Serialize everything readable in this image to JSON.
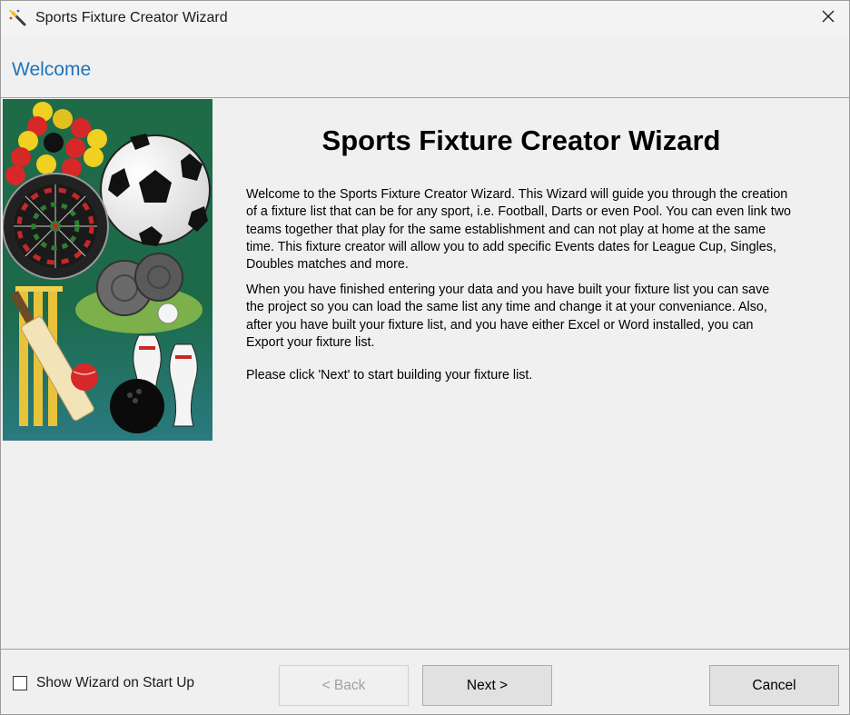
{
  "window": {
    "title": "Sports Fixture Creator Wizard"
  },
  "header": {
    "title": "Welcome"
  },
  "main": {
    "title": "Sports Fixture Creator Wizard",
    "paragraphs": [
      "Welcome to the Sports Fixture Creator Wizard. This Wizard will guide you through the creation of a fixture list that can be for any sport, i.e. Football, Darts or even Pool. You can even link two teams together that play for the same establishment and can not play at home at the same time. This fixture creator will allow you to add specific Events dates for League Cup, Singles, Doubles matches and more.",
      "When you have finished entering your data and you have built your fixture list you can save the project so you can load the same list any time and change it at your conveniance. Also, after you have built your fixture list, and you have either Excel or Word installed, you can Export your fixture list.",
      "Please click 'Next' to start building your fixture list."
    ]
  },
  "footer": {
    "checkbox_label": "Show Wizard on Start Up",
    "checkbox_checked": false,
    "back_label": "< Back",
    "next_label": "Next >",
    "cancel_label": "Cancel"
  },
  "icons": {
    "title": "wizard-wand-icon",
    "close": "close-icon",
    "side_image": "sports-collage-image"
  },
  "colors": {
    "header_title": "#1c75bc",
    "image_background": "#1f6b48"
  }
}
